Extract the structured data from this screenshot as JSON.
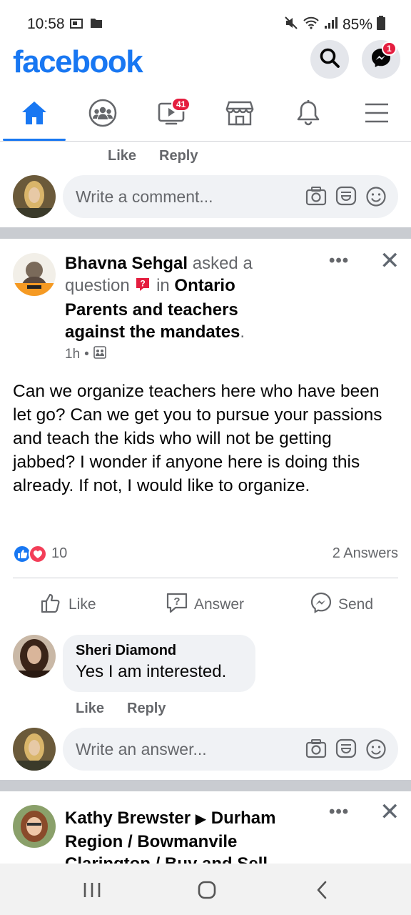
{
  "status_bar": {
    "time": "10:58",
    "battery": "85%"
  },
  "header": {
    "logo": "facebook",
    "messenger_badge": "1"
  },
  "nav": {
    "watch_badge": "41"
  },
  "prev_comment": {
    "like": "Like",
    "reply": "Reply",
    "placeholder": "Write a comment..."
  },
  "post": {
    "author": "Bhavna Sehgal",
    "verb1": " asked a question ",
    "in_word": " in ",
    "group": "Ontario Parents and teachers against the mandates",
    "period": ".",
    "time": "1h",
    "dot": "•",
    "body": "Can we organize teachers here who have been let go? Can we get you to pursue your passions and teach the kids who will not be getting jabbed? I wonder if anyone here is doing this already. If not, I would like to organize.",
    "reaction_count": "10",
    "answers_count": "2 Answers",
    "actions": {
      "like": "Like",
      "answer": "Answer",
      "send": "Send"
    }
  },
  "reply": {
    "name": "Sheri Diamond",
    "text": "Yes I am interested.",
    "like": "Like",
    "reply": "Reply"
  },
  "answer_input": {
    "placeholder": "Write an answer..."
  },
  "next_post": {
    "author": "Kathy Brewster",
    "arrow": "▶",
    "group": "Durham Region / Bowmanvile Clarington / Buy and Sell"
  },
  "colors": {
    "brand": "#1877f2",
    "badge": "#e41e3f",
    "secondary_text": "#65676b"
  }
}
